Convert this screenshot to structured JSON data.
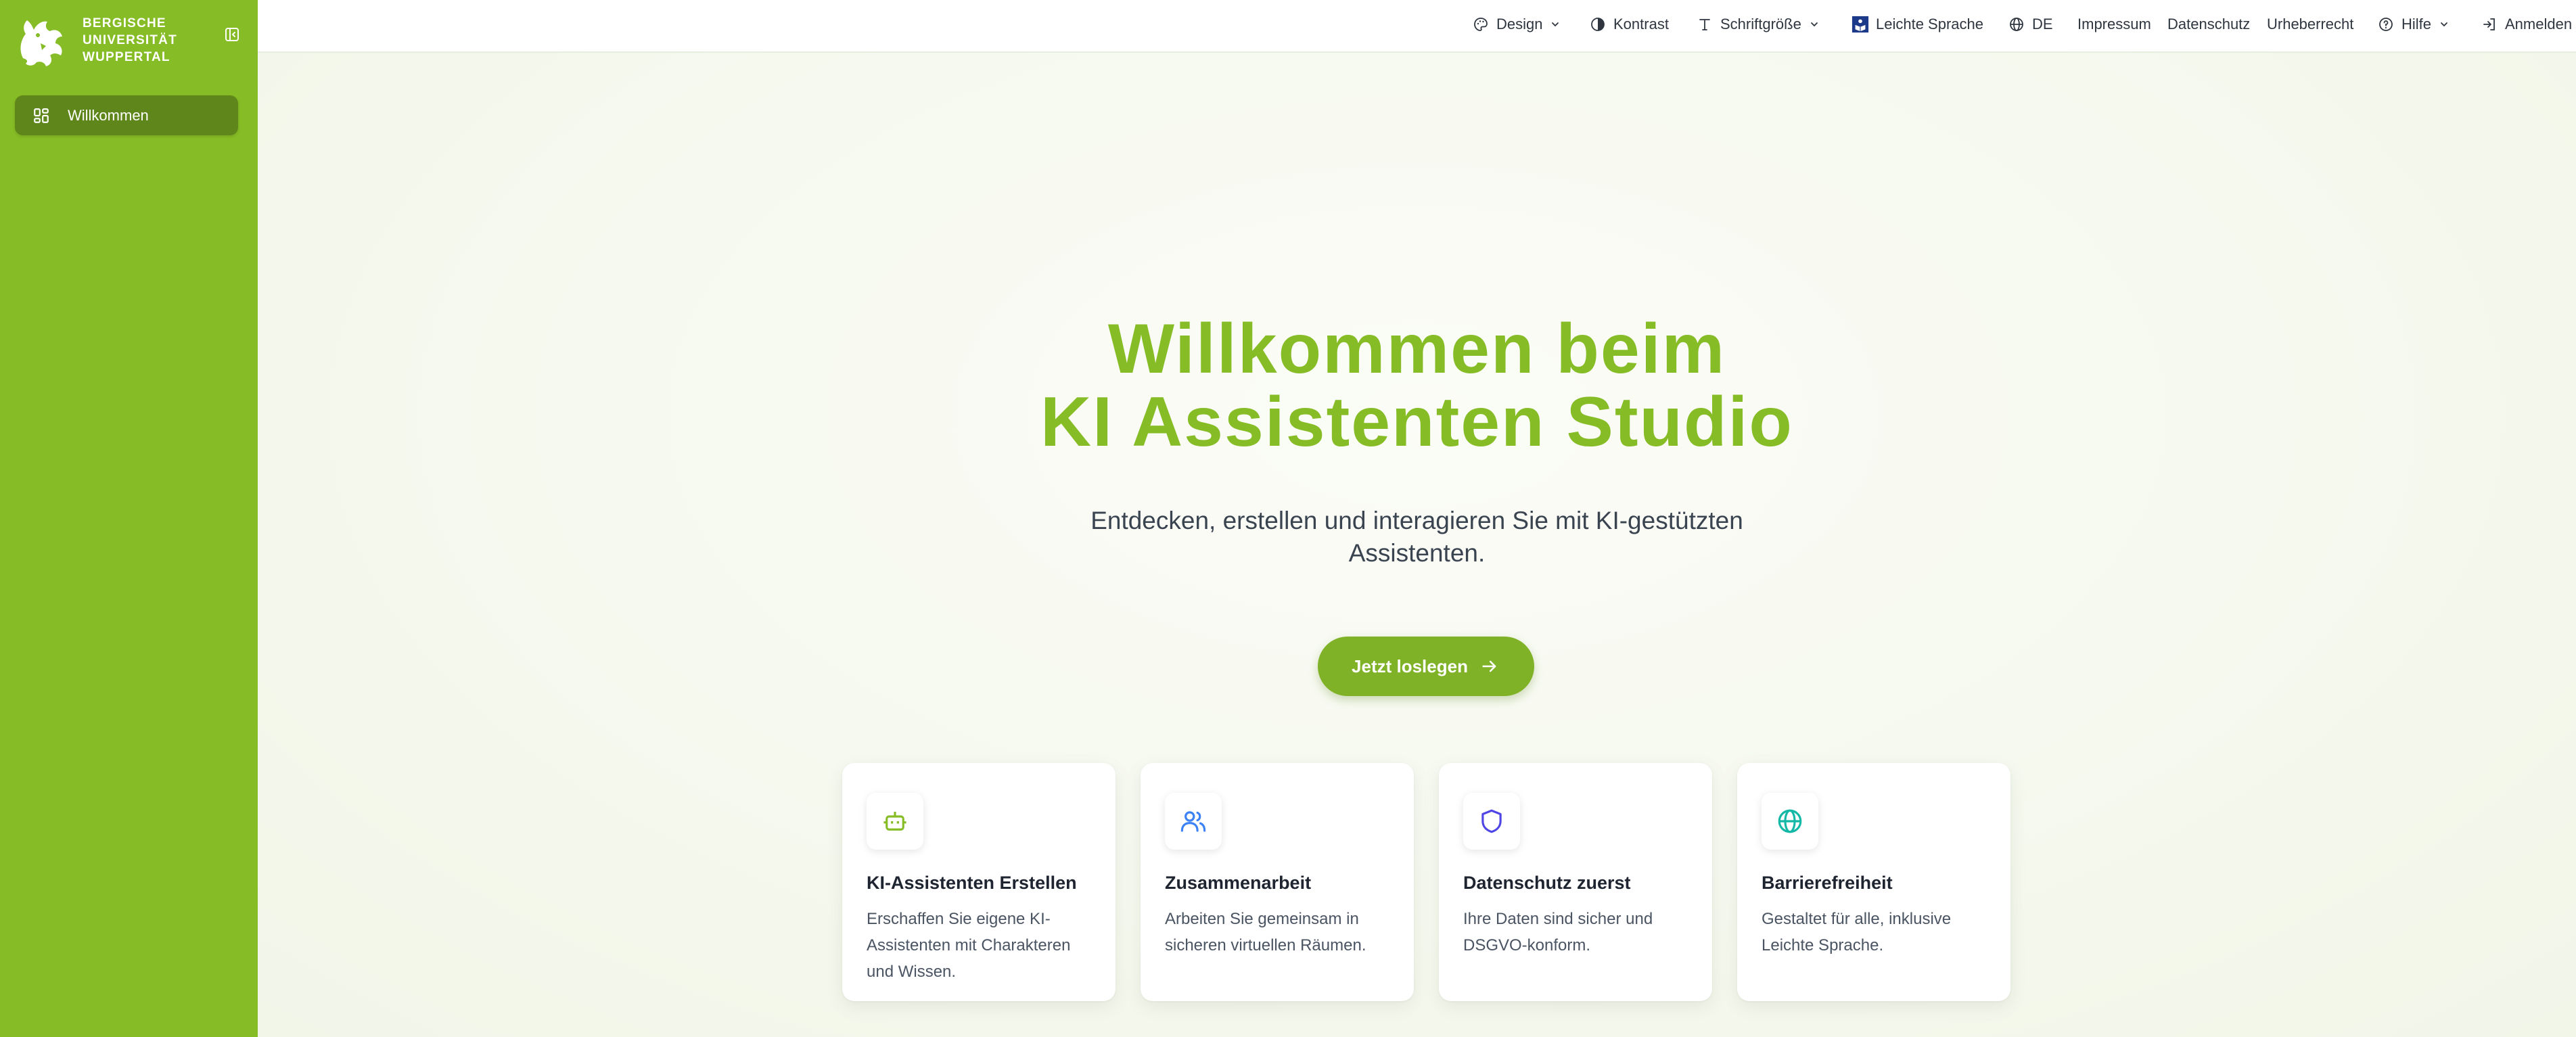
{
  "sidebar": {
    "brand": {
      "line1": "BERGISCHE",
      "line2": "UNIVERSITÄT",
      "line3": "WUPPERTAL"
    },
    "items": [
      {
        "label": "Willkommen",
        "icon": "dashboard-grid-icon"
      }
    ]
  },
  "topbar": {
    "design": "Design",
    "kontrast": "Kontrast",
    "schriftgroesse": "Schriftgröße",
    "leichte_sprache": "Leichte Sprache",
    "language": "DE",
    "impressum": "Impressum",
    "datenschutz": "Datenschutz",
    "urheberrecht": "Urheberrecht",
    "hilfe": "Hilfe",
    "anmelden": "Anmelden"
  },
  "hero": {
    "title_line1": "Willkommen beim",
    "title_line2": "KI Assistenten Studio",
    "subtitle": "Entdecken, erstellen und interagieren Sie mit KI-gestützten Assistenten.",
    "cta": "Jetzt loslegen"
  },
  "features": [
    {
      "title": "KI-Assistenten Erstellen",
      "desc": "Erschaffen Sie eigene KI-Assistenten mit Charakteren und Wissen.",
      "icon": "robot-icon",
      "color": "#86bc25"
    },
    {
      "title": "Zusammenarbeit",
      "desc": "Arbeiten Sie gemeinsam in sicheren virtuellen Räumen.",
      "icon": "users-icon",
      "color": "#3b82f6"
    },
    {
      "title": "Datenschutz zuerst",
      "desc": "Ihre Daten sind sicher und DSGVO-konform.",
      "icon": "shield-icon",
      "color": "#4f46e5"
    },
    {
      "title": "Barrierefreiheit",
      "desc": "Gestaltet für alle, inklusive Leichte Sprache.",
      "icon": "globe-icon",
      "color": "#14b8a6"
    }
  ],
  "colors": {
    "brand_green": "#86bc25",
    "nav_active": "#5f861a",
    "leichte_sprache_badge": "#1d3a8a"
  }
}
